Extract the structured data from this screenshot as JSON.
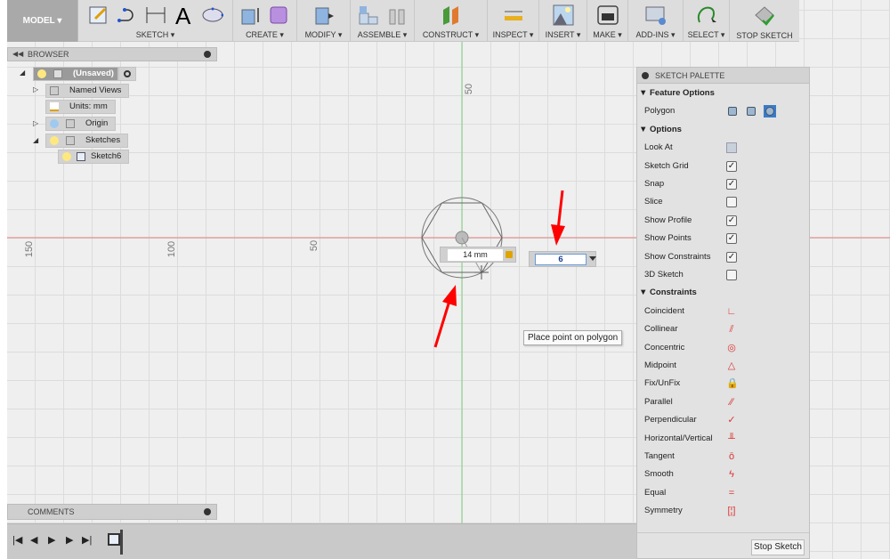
{
  "toolbar": {
    "model_label": "MODEL ▾",
    "groups": [
      {
        "label": "SKETCH ▾"
      },
      {
        "label": "CREATE ▾"
      },
      {
        "label": "MODIFY ▾"
      },
      {
        "label": "ASSEMBLE ▾"
      },
      {
        "label": "CONSTRUCT ▾"
      },
      {
        "label": "INSPECT ▾"
      },
      {
        "label": "INSERT ▾"
      },
      {
        "label": "MAKE ▾"
      },
      {
        "label": "ADD-INS ▾"
      },
      {
        "label": "SELECT ▾"
      },
      {
        "label": "STOP SKETCH"
      }
    ]
  },
  "browser": {
    "title": "BROWSER",
    "nodes": [
      {
        "label": "(Unsaved)"
      },
      {
        "label": "Named Views"
      },
      {
        "label": "Units: mm"
      },
      {
        "label": "Origin"
      },
      {
        "label": "Sketches"
      },
      {
        "label": "Sketch6"
      }
    ]
  },
  "canvas": {
    "axis_labels": {
      "x150": "150",
      "x100": "100",
      "x50": "50",
      "y50": "50"
    },
    "dimension_value": "14 mm",
    "sides_value": "6",
    "tooltip": "Place point on polygon",
    "colors": {
      "x_axis": "#e08080",
      "y_axis": "#7fd27f",
      "arrow": "#ff0000"
    }
  },
  "palette": {
    "title": "SKETCH PALETTE",
    "feature_options_label": "Feature Options",
    "polygon_label": "Polygon",
    "polygon_types": [
      "circumscribed-polygon",
      "inscribed-polygon",
      "edge-polygon"
    ],
    "polygon_selected": 2,
    "options_label": "Options",
    "options": [
      {
        "label": "Look At",
        "type": "button"
      },
      {
        "label": "Sketch Grid",
        "checked": true
      },
      {
        "label": "Snap",
        "checked": true
      },
      {
        "label": "Slice",
        "checked": false
      },
      {
        "label": "Show Profile",
        "checked": true
      },
      {
        "label": "Show Points",
        "checked": true
      },
      {
        "label": "Show Constraints",
        "checked": true
      },
      {
        "label": "3D Sketch",
        "checked": false
      }
    ],
    "constraints_label": "Constraints",
    "constraints": [
      {
        "label": "Coincident",
        "icon": "coincident-icon",
        "glyph": "∟"
      },
      {
        "label": "Collinear",
        "icon": "collinear-icon",
        "glyph": "⫽"
      },
      {
        "label": "Concentric",
        "icon": "concentric-icon",
        "glyph": "◎"
      },
      {
        "label": "Midpoint",
        "icon": "midpoint-icon",
        "glyph": "△"
      },
      {
        "label": "Fix/UnFix",
        "icon": "lock-icon",
        "glyph": "🔒"
      },
      {
        "label": "Parallel",
        "icon": "parallel-icon",
        "glyph": "∕∕"
      },
      {
        "label": "Perpendicular",
        "icon": "perpendicular-icon",
        "glyph": "✓"
      },
      {
        "label": "Horizontal/Vertical",
        "icon": "horizontal-vertical-icon",
        "glyph": "╨"
      },
      {
        "label": "Tangent",
        "icon": "tangent-icon",
        "glyph": "ō"
      },
      {
        "label": "Smooth",
        "icon": "smooth-icon",
        "glyph": "ϟ"
      },
      {
        "label": "Equal",
        "icon": "equal-icon",
        "glyph": "="
      },
      {
        "label": "Symmetry",
        "icon": "symmetry-icon",
        "glyph": "[¦]"
      }
    ],
    "stop_sketch_label": "Stop Sketch"
  },
  "comments": {
    "title": "COMMENTS"
  }
}
